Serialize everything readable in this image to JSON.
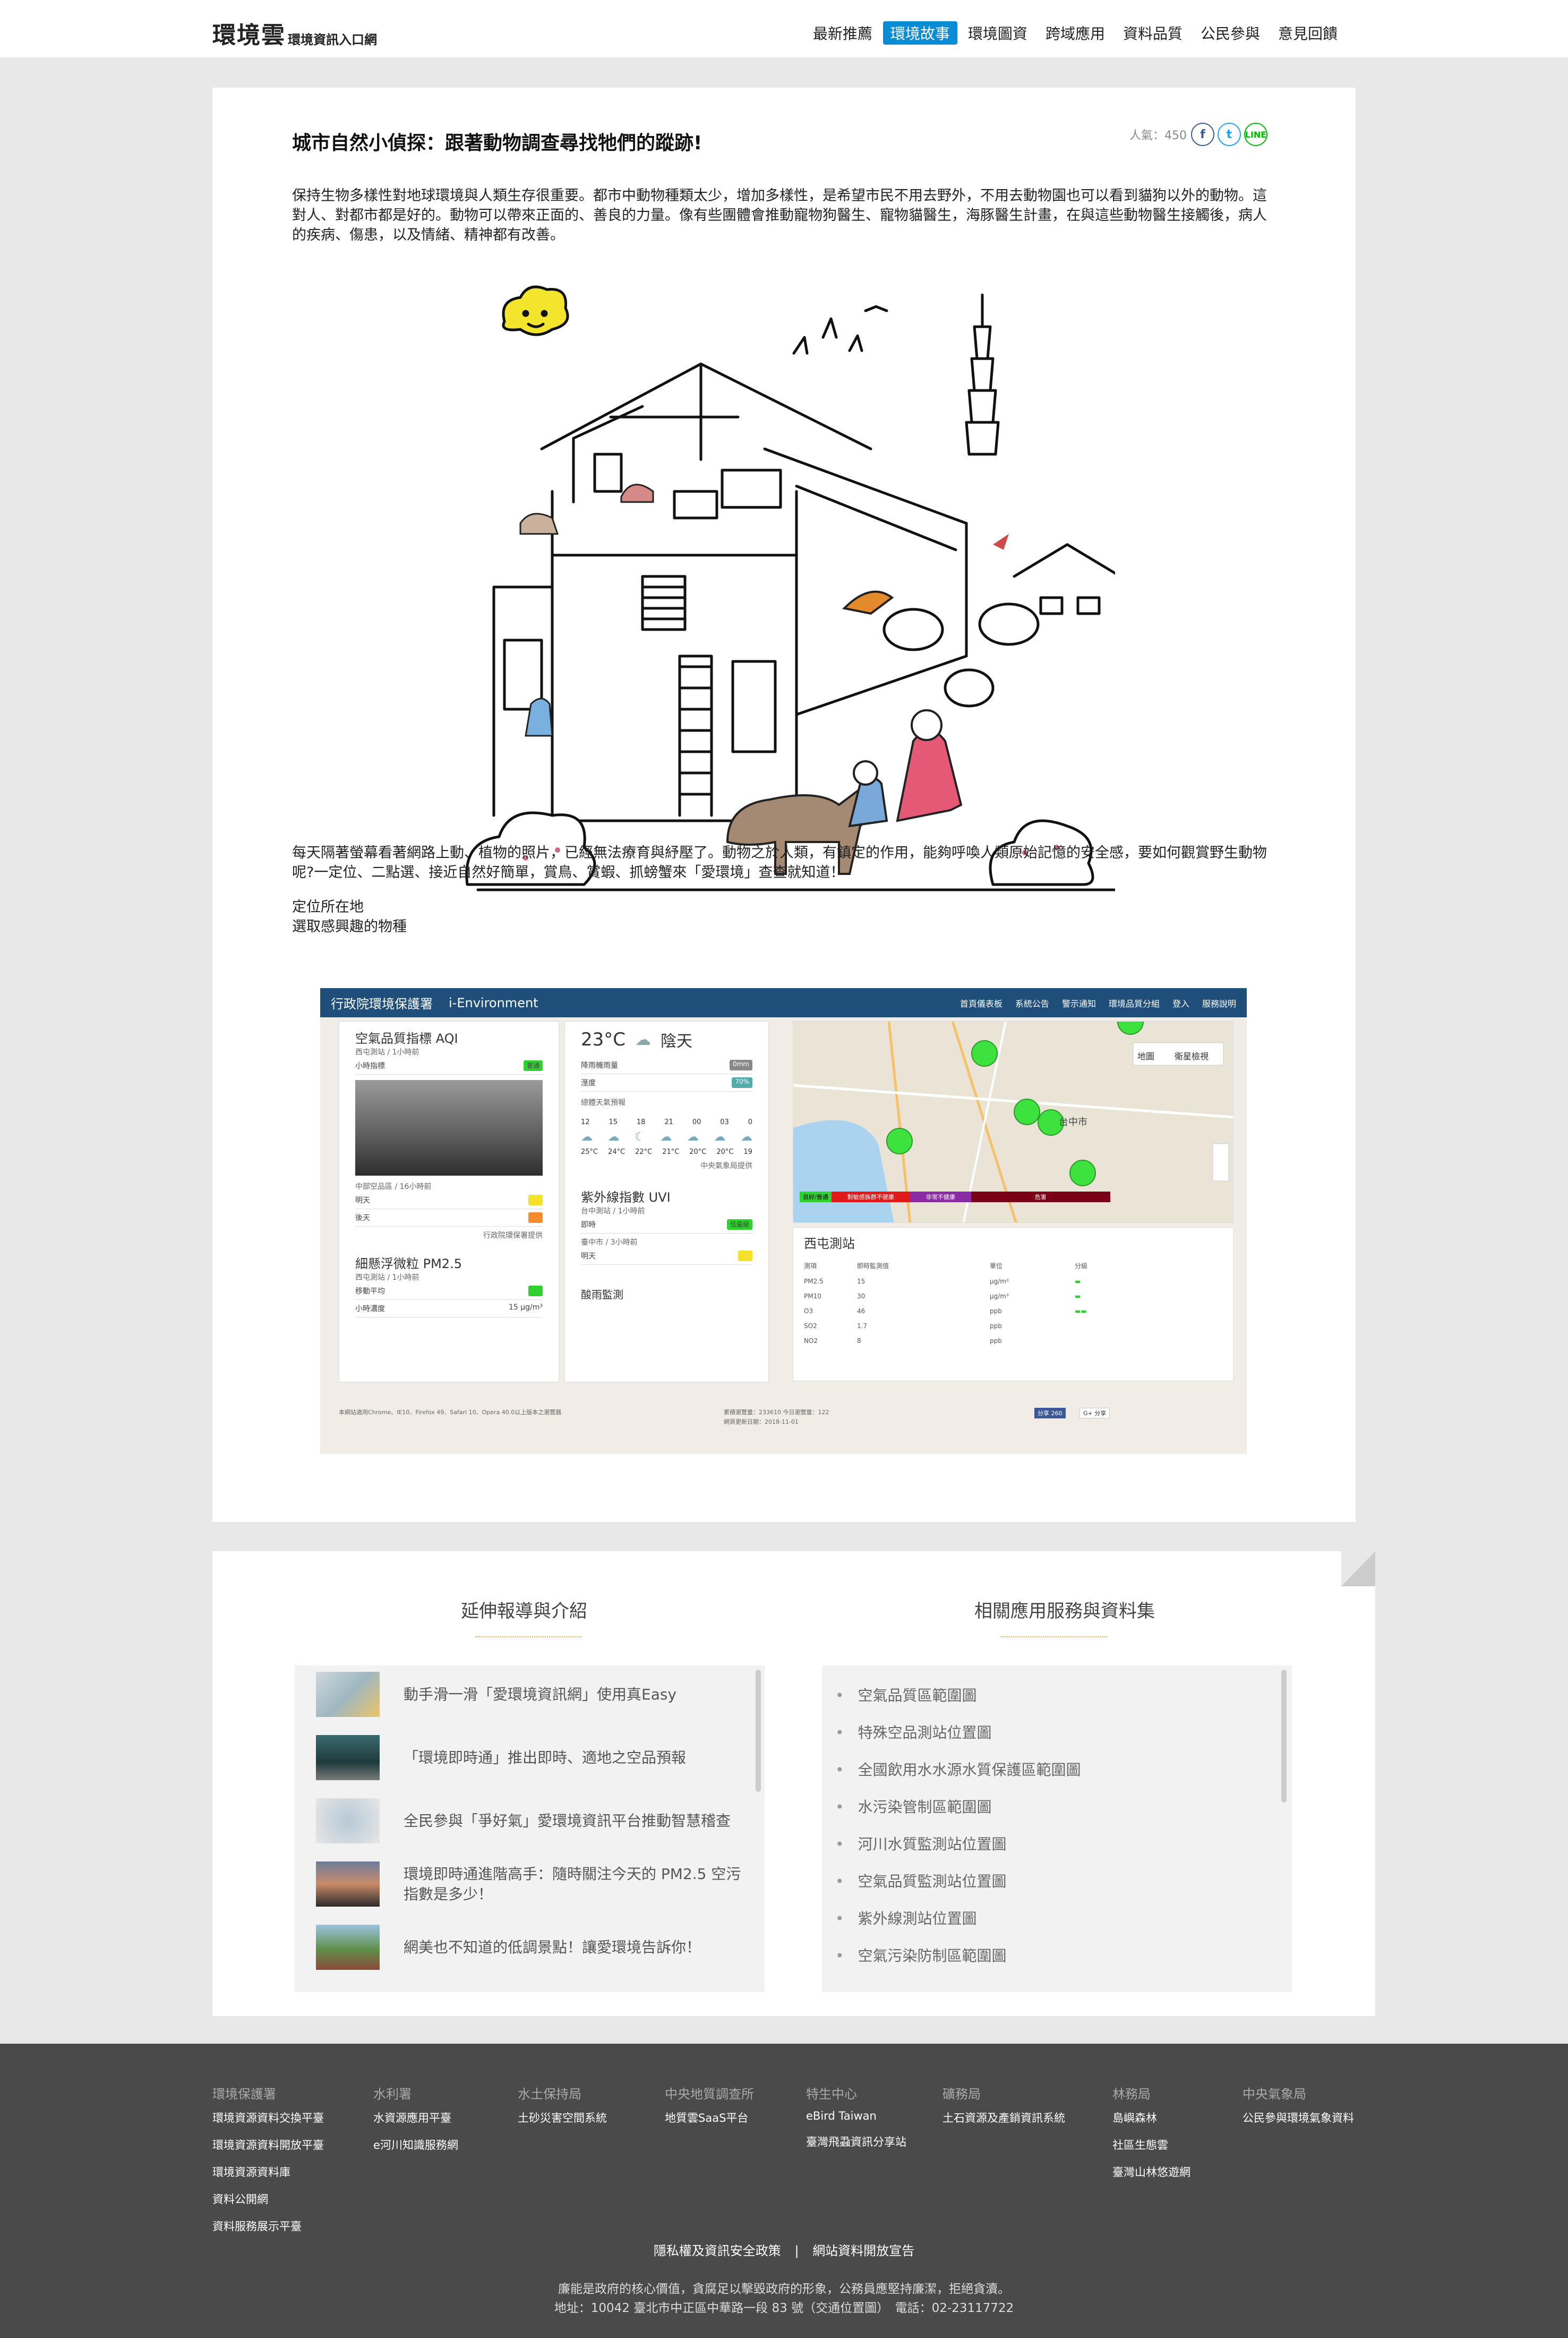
{
  "header": {
    "logo_main": "環境雲",
    "logo_sub": "環境資訊入口網",
    "nav": [
      "最新推薦",
      "環境故事",
      "環境圖資",
      "跨域應用",
      "資料品質",
      "公民參與",
      "意見回饋"
    ],
    "active_nav": "環境故事"
  },
  "article": {
    "title": "城市自然小偵探：跟著動物調查尋找牠們的蹤跡!",
    "popularity": "人氣：450",
    "share": {
      "facebook": "f",
      "twitter": "t",
      "line": "LINE"
    },
    "para1": "保持生物多樣性對地球環境與人類生存很重要。都市中動物種類太少，增加多樣性，是希望市民不用去野外，不用去動物園也可以看到貓狗以外的動物。這對人、對都市都是好的。動物可以帶來正面的、善良的力量。像有些團體會推動寵物狗醫生、寵物貓醫生，海豚醫生計畫，在與這些動物醫生接觸後，病人的疾病、傷患，以及情緒、精神都有改善。",
    "para2": "每天隔著螢幕看著網路上動、植物的照片，已經無法療育與紓壓了。動物之於人類，有鎮定的作用，能夠呼喚人類原始記憶的安全感，要如何觀賞野生動物呢?一定位、二點選、接近自然好簡單，賞鳥、賞蝦、抓螃蟹來「愛環境」查查就知道！",
    "step1": "定位所在地",
    "step2": "選取感興趣的物種"
  },
  "app_screenshot": {
    "agency": "行政院環境保護署",
    "brand": "i-Environment",
    "top_links": [
      "首頁儀表板",
      "系統公告",
      "警示通知",
      "環境品質分組",
      "登入",
      "服務說明"
    ],
    "aqi_title": "空氣品質指標 AQI",
    "aqi_station": "西屯測站 / 1小時前",
    "aqi_hour": "小時指標",
    "aqi_value": "普通",
    "forecast_area": "中部空品區 / 16小時前",
    "tomorrow": "明天",
    "day_after": "後天",
    "source_aq": "行政院環保署提供",
    "pm_title": "細懸浮微粒 PM2.5",
    "pm_station": "西屯測站 / 1小時前",
    "pm_avg": "移動平均",
    "pm_hour": "小時濃度",
    "pm_value": "15 μg/m³",
    "weather_temp": "23°C",
    "weather_desc": "陰天",
    "rain_label": "降雨機雨量",
    "rain_value": "0mm",
    "humidity_label": "溼度",
    "humidity_value": "70%",
    "forecast_label": "總體天氣預報",
    "hours": [
      "12",
      "15",
      "18",
      "21",
      "00",
      "03",
      "0"
    ],
    "temps": [
      "25°C",
      "24°C",
      "22°C",
      "21°C",
      "20°C",
      "20°C",
      "19"
    ],
    "cwb_source": "中央氣象局提供",
    "uv_title": "紫外線指數 UVI",
    "uv_station": "台中測站 / 1小時前",
    "uv_now": "即時",
    "uv_value": "低量級",
    "uv_area": "臺中市 / 3小時前",
    "rain_monitor": "酸雨監測",
    "map_tabs": [
      "地圖",
      "衛星檢視"
    ],
    "map_city": "台中市",
    "legend": [
      "良好/普通",
      "對敏感族群不健康",
      "非常不健康",
      "危害"
    ],
    "station_title": "西屯測站",
    "station_cols": [
      "測項",
      "即時監測值",
      "單位",
      "分級"
    ],
    "station_rows": [
      [
        "PM2.5",
        "15",
        "μg/m³"
      ],
      [
        "PM10",
        "30",
        "μg/m³"
      ],
      [
        "O3",
        "46",
        "ppb"
      ],
      [
        "SO2",
        "1.7",
        "ppb"
      ],
      [
        "NO2",
        "8",
        "ppb"
      ]
    ],
    "footer_left": "本網站適用Chrome、IE10、Firefox 49、Safari 10、Opera 40.0以上版本之瀏覽器",
    "footer_stats": "累積瀏覽量：233610 今日瀏覽量：122",
    "update": "網頁更新日期：2018-11-01",
    "fb_share": "分享 260",
    "gplus": "G+ 分享"
  },
  "related": {
    "left_title": "延伸報導與介紹",
    "right_title": "相關應用服務與資料集",
    "news": [
      "動手滑一滑「愛環境資訊網」使用真Easy",
      "「環境即時通」推出即時、適地之空品預報",
      "全民參與「爭好氣」愛環境資訊平台推動智慧稽查",
      "環境即時通進階高手：隨時關注今天的 PM2.5 空污指數是多少！",
      "網美也不知道的低調景點！讓愛環境告訴你！"
    ],
    "services": [
      "空氣品質區範圍圖",
      "特殊空品測站位置圖",
      "全國飲用水水源水質保護區範圍圖",
      "水污染管制區範圍圖",
      "河川水質監測站位置圖",
      "空氣品質監測站位置圖",
      "紫外線測站位置圖",
      "空氣污染防制區範圍圖"
    ]
  },
  "footer": {
    "columns": [
      {
        "head": "環境保護署",
        "links": [
          "環境資源資料交換平臺",
          "環境資源資料開放平臺",
          "環境資源資料庫",
          "資料公開網",
          "資料服務展示平臺"
        ]
      },
      {
        "head": "水利署",
        "links": [
          "水資源應用平臺",
          "e河川知識服務網"
        ]
      },
      {
        "head": "水土保持局",
        "links": [
          "土砂災害空間系統"
        ]
      },
      {
        "head": "中央地質調查所",
        "links": [
          "地質雲SaaS平台"
        ]
      },
      {
        "head": "特生中心",
        "links": [
          "eBird Taiwan",
          "臺灣飛蝨資訊分享站"
        ]
      },
      {
        "head": "礦務局",
        "links": [
          "土石資源及產銷資訊系統"
        ]
      },
      {
        "head": "林務局",
        "links": [
          "島嶼森林",
          "社區生態雲",
          "臺灣山林悠遊網"
        ]
      },
      {
        "head": "中央氣象局",
        "links": [
          "公民參與環境氣象資料"
        ]
      }
    ],
    "policy_privacy": "隱私權及資訊安全政策",
    "policy_open": "網站資料開放宣告",
    "slogan": "廉能是政府的核心價值，貪腐足以擊毀政府的形象，公務員應堅持廉潔，拒絕貪瀆。",
    "address": "地址：10042 臺北市中正區中華路一段 83 號（交通位置圖）　電話：02-23117722"
  },
  "colors": {
    "accent": "#0a8bd6",
    "footer": "#4a4a4a",
    "divider": "#e6b14c"
  }
}
